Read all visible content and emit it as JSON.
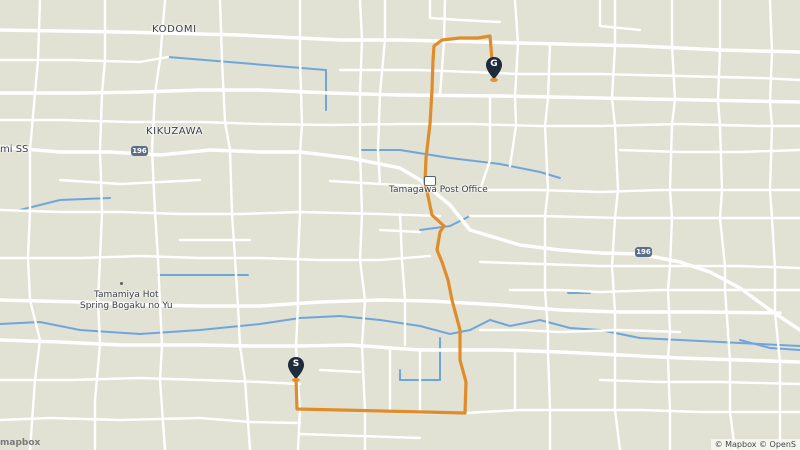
{
  "map": {
    "places": {
      "kodomi": "KODOMI",
      "kikuzawa": "KIKUZAWA",
      "ss": "mi SS",
      "post_office": "Tamagawa Post Office",
      "onsen_line1": "Tamamiya Hot",
      "onsen_line2": "Spring Bogaku no Yu"
    },
    "route_shields": [
      "196",
      "196"
    ],
    "markers": {
      "start": "S",
      "goal": "G"
    },
    "attribution": "© Mapbox © OpenS",
    "logo": "mapbox",
    "colors": {
      "background": "#e1e1d4",
      "road": "#ffffff",
      "water": "#6ea6dc",
      "route": "#e08c2b",
      "marker": "#1d2b3d",
      "shield": "#5b6f8a"
    },
    "icons": {
      "post_office": "envelope-icon",
      "start_pin": "map-pin-icon",
      "goal_pin": "map-pin-icon"
    }
  }
}
